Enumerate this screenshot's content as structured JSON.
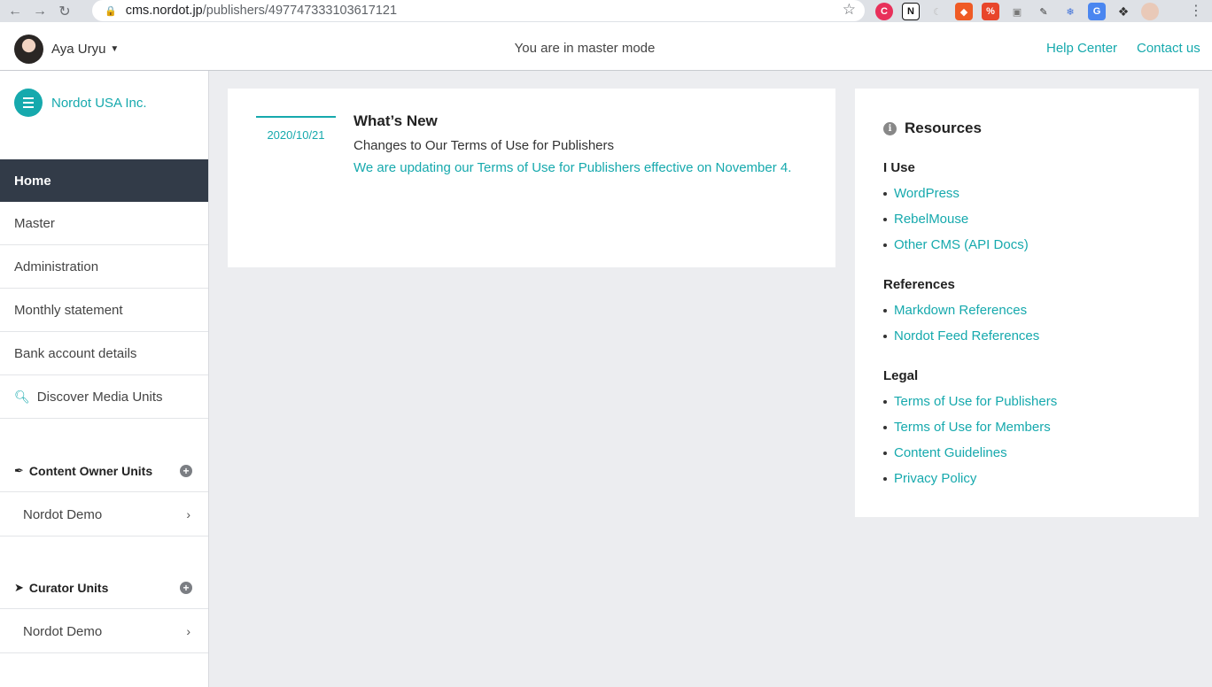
{
  "browser": {
    "url_host": "cms.nordot.jp",
    "url_path": "/publishers/497747333103617121",
    "back_icon": "arrow-left",
    "forward_icon": "arrow-right",
    "reload_icon": "reload"
  },
  "header": {
    "user_name": "Aya Uryu",
    "mode_text": "You are in master mode",
    "help_link": "Help Center",
    "contact_link": "Contact us"
  },
  "sidebar": {
    "org_name": "Nordot USA Inc.",
    "nav": [
      {
        "label": "Home",
        "active": true
      },
      {
        "label": "Master"
      },
      {
        "label": "Administration"
      },
      {
        "label": "Monthly statement"
      },
      {
        "label": "Bank account details"
      },
      {
        "label": "Discover Media Units"
      }
    ],
    "content_owner": {
      "title": "Content Owner Units",
      "item": "Nordot Demo"
    },
    "curator": {
      "title": "Curator Units",
      "item": "Nordot Demo"
    }
  },
  "news": {
    "date": "2020/10/21",
    "title": "What’s New",
    "subtitle": "Changes to Our Terms of Use for Publishers",
    "link": "We are updating our Terms of Use for Publishers effective on November 4",
    "link_suffix": "."
  },
  "resources": {
    "title": "Resources",
    "groups": [
      {
        "heading": "I Use",
        "links": [
          "WordPress",
          "RebelMouse",
          "Other CMS (API Docs)"
        ]
      },
      {
        "heading": "References",
        "links": [
          "Markdown References",
          "Nordot Feed References"
        ]
      },
      {
        "heading": "Legal",
        "links": [
          "Terms of Use for Publishers",
          "Terms of Use for Members",
          "Content Guidelines",
          "Privacy Policy"
        ]
      }
    ]
  },
  "colors": {
    "accent": "#16a9ad",
    "sidebar_active": "#323b48",
    "page_bg": "#ecedf0"
  }
}
